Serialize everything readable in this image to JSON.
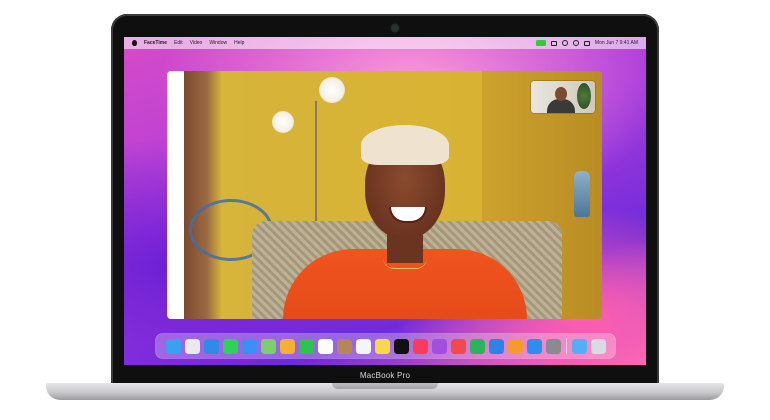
{
  "device": {
    "label": "MacBook Pro"
  },
  "menubar": {
    "app_name": "FaceTime",
    "items": [
      "Edit",
      "Video",
      "Window",
      "Help"
    ],
    "clock": "Mon Jun 7  9:41 AM"
  },
  "facetime": {
    "status_color": "#2ecc40"
  },
  "dock": {
    "icons": [
      {
        "name": "finder-icon",
        "color": "#3aa0f0"
      },
      {
        "name": "launchpad-icon",
        "color": "#e9e9ee"
      },
      {
        "name": "safari-icon",
        "color": "#2f8be8"
      },
      {
        "name": "messages-icon",
        "color": "#2fd15a"
      },
      {
        "name": "mail-icon",
        "color": "#3d8ff5"
      },
      {
        "name": "maps-icon",
        "color": "#7ccf6d"
      },
      {
        "name": "photos-icon",
        "color": "#f2b134"
      },
      {
        "name": "facetime-icon",
        "color": "#2fc24f"
      },
      {
        "name": "calendar-icon",
        "color": "#ffffff"
      },
      {
        "name": "contacts-icon",
        "color": "#b4865a"
      },
      {
        "name": "reminders-icon",
        "color": "#f5f5f5"
      },
      {
        "name": "notes-icon",
        "color": "#f7d84b"
      },
      {
        "name": "tv-icon",
        "color": "#111111"
      },
      {
        "name": "music-icon",
        "color": "#fa3c5a"
      },
      {
        "name": "podcasts-icon",
        "color": "#a44ee0"
      },
      {
        "name": "news-icon",
        "color": "#f24a4a"
      },
      {
        "name": "numbers-icon",
        "color": "#2fb35a"
      },
      {
        "name": "keynote-icon",
        "color": "#2f83e8"
      },
      {
        "name": "pages-icon",
        "color": "#f59a2c"
      },
      {
        "name": "app-store-icon",
        "color": "#2f8cf0"
      },
      {
        "name": "system-preferences-icon",
        "color": "#8a8a90"
      },
      {
        "name": "downloads-folder-icon",
        "color": "#56aef2"
      },
      {
        "name": "trash-icon",
        "color": "#d8dce2"
      }
    ]
  }
}
